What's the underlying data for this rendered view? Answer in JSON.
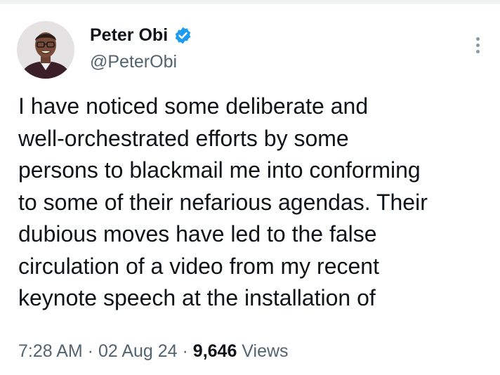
{
  "author": {
    "display_name": "Peter Obi",
    "handle": "@PeterObi",
    "verified": true,
    "verified_color": "#1d9bf0"
  },
  "tweet": {
    "text_lines": [
      "I have noticed some deliberate and",
      "well-orchestrated efforts by some",
      "persons to blackmail me into conforming",
      "to some of their nefarious agendas. Their",
      "dubious moves have led to the false",
      "circulation of a video from my recent",
      "keynote speech at the installation of"
    ]
  },
  "meta": {
    "time": "7:28 AM",
    "separator": " · ",
    "date": "02 Aug 24",
    "views_count": "9,646",
    "views_label": " Views"
  },
  "icons": {
    "verified": "verified-badge-icon",
    "more": "more-options-icon"
  }
}
